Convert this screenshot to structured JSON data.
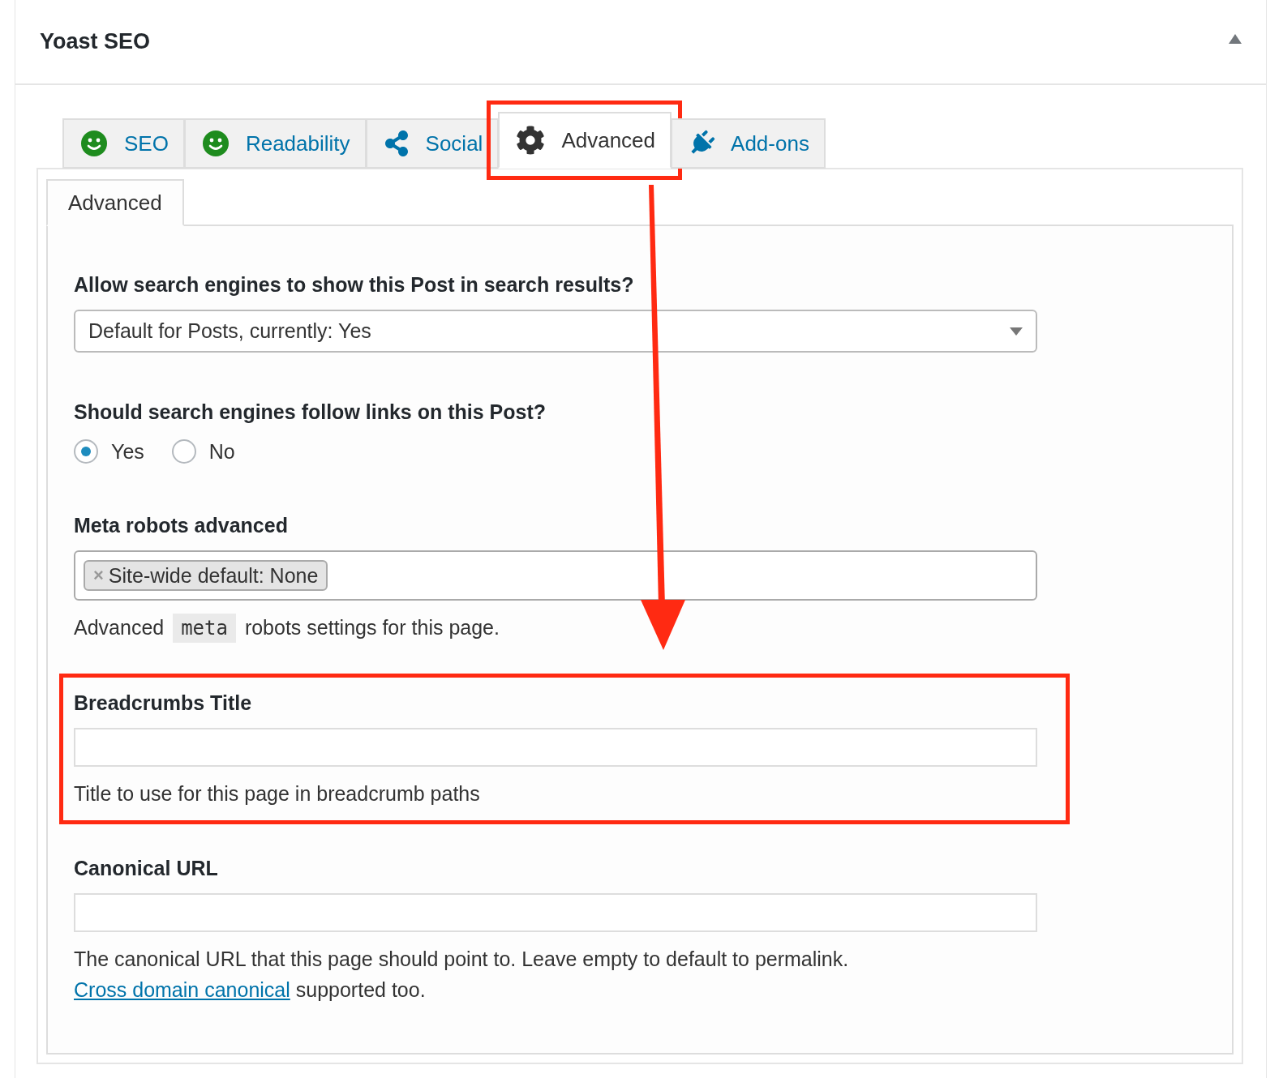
{
  "panel": {
    "title": "Yoast SEO",
    "expanded": true
  },
  "tabs": [
    {
      "label": "SEO",
      "selected": false,
      "highlighted": false,
      "color": "#1e8c1e"
    },
    {
      "label": "Readability",
      "selected": false,
      "highlighted": false,
      "color": "#1e8c1e"
    },
    {
      "label": "Social",
      "selected": false,
      "highlighted": false
    },
    {
      "label": "Advanced",
      "selected": true,
      "highlighted": true
    },
    {
      "label": "Add-ons",
      "selected": false,
      "highlighted": false
    }
  ],
  "subtabs": [
    {
      "label": "Advanced",
      "selected": true
    }
  ],
  "fields": [
    {
      "kind": "select",
      "label": "Allow search engines to show this Post in search results?",
      "value": "Default for Posts, currently: Yes",
      "highlighted": false
    },
    {
      "kind": "radio",
      "label": "Should search engines follow links on this Post?",
      "options": [
        {
          "label": "Yes",
          "selected": true
        },
        {
          "label": "No",
          "selected": false
        }
      ],
      "highlighted": false
    },
    {
      "kind": "tags",
      "label": "Meta robots advanced",
      "tags": [
        {
          "remove": "×",
          "label": "Site-wide default: None"
        }
      ],
      "help": [
        {
          "kind": "text",
          "text": "Advanced "
        },
        {
          "kind": "code",
          "text": "meta"
        },
        {
          "kind": "text",
          "text": " robots settings for this page."
        }
      ],
      "highlighted": false
    },
    {
      "kind": "text",
      "label": "Breadcrumbs Title",
      "help": [
        {
          "kind": "text",
          "text": "Title to use for this page in breadcrumb paths"
        }
      ],
      "highlighted": true
    },
    {
      "kind": "text",
      "label": "Canonical URL",
      "help": [
        {
          "kind": "text",
          "text": "The canonical URL that this page should point to. Leave empty to default to permalink. "
        },
        {
          "kind": "link",
          "text": "Cross domain canonical"
        },
        {
          "kind": "text",
          "text": " supported too."
        }
      ],
      "highlighted": false
    }
  ]
}
